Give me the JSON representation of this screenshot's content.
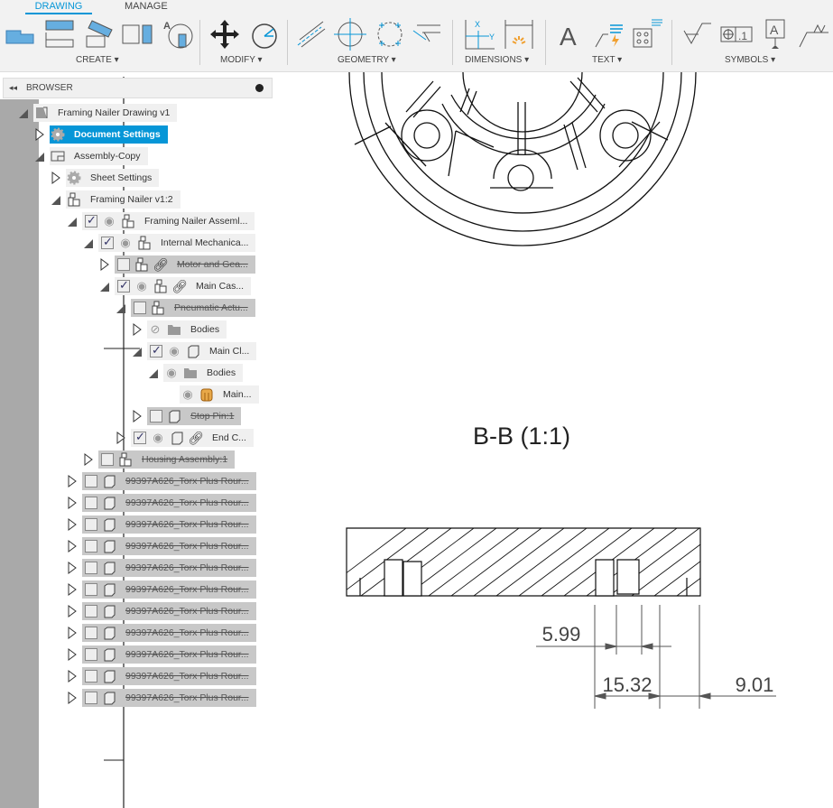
{
  "tabs": [
    {
      "label": "DRAWING",
      "active": true
    },
    {
      "label": "MANAGE",
      "active": false
    }
  ],
  "groups": [
    {
      "label": "CREATE ▾"
    },
    {
      "label": "MODIFY ▾"
    },
    {
      "label": "GEOMETRY ▾"
    },
    {
      "label": "DIMENSIONS ▾"
    },
    {
      "label": "TEXT ▾"
    },
    {
      "label": "SYMBOLS ▾"
    }
  ],
  "browser": {
    "title": "BROWSER",
    "collapse_icon": "double-chevron-left-icon",
    "minus_icon": "minus-circle-icon"
  },
  "tree": [
    {
      "label": "Framing Nailer Drawing v1",
      "level": 0,
      "exp": "open",
      "icon": "drawing",
      "state": "normal"
    },
    {
      "label": "Document Settings",
      "level": 1,
      "exp": "closed",
      "icon": "gear",
      "state": "sel"
    },
    {
      "label": "Assembly-Copy",
      "level": 1,
      "exp": "open",
      "icon": "sheet",
      "state": "normal"
    },
    {
      "label": "Sheet Settings",
      "level": 2,
      "exp": "closed",
      "icon": "gear",
      "state": "normal"
    },
    {
      "label": "Framing Nailer v1:2",
      "level": 2,
      "exp": "open",
      "icon": "assembly",
      "state": "normal"
    },
    {
      "label": "Framing Nailer Asseml...",
      "level": 3,
      "exp": "open",
      "cb": "on",
      "eye": "on",
      "icon": "assembly",
      "state": "normal"
    },
    {
      "label": "Internal Mechanica...",
      "level": 4,
      "exp": "open",
      "cb": "on",
      "eye": "on",
      "icon": "assembly",
      "state": "normal"
    },
    {
      "label": "Motor and Gea...",
      "level": 5,
      "exp": "closed",
      "cb": "off",
      "icon": "assembly",
      "link": true,
      "state": "supp"
    },
    {
      "label": "Main Cas...",
      "level": 5,
      "exp": "open",
      "cb": "on",
      "eye": "on",
      "icon": "assembly",
      "link": true,
      "state": "normal"
    },
    {
      "label": "Pneumatic Actu...",
      "level": 6,
      "exp": "open",
      "cb": "off",
      "icon": "assembly",
      "state": "supp"
    },
    {
      "label": "Bodies",
      "level": 7,
      "exp": "closed",
      "eye": "off",
      "icon": "folder",
      "state": "normal"
    },
    {
      "label": "Main Cl...",
      "level": 7,
      "exp": "open",
      "cb": "on",
      "eye": "on",
      "icon": "component",
      "state": "normal"
    },
    {
      "label": "Bodies",
      "level": 8,
      "exp": "open",
      "eye": "on",
      "icon": "folder",
      "state": "normal"
    },
    {
      "label": "Main...",
      "level": 9,
      "exp": "none",
      "eye": "on",
      "icon": "body",
      "state": "normal"
    },
    {
      "label": "Stop Pin:1",
      "level": 7,
      "exp": "closed",
      "cb": "off",
      "icon": "component",
      "state": "supp"
    },
    {
      "label": "End C...",
      "level": 6,
      "exp": "closed",
      "cb": "on",
      "eye": "on",
      "icon": "component",
      "link": true,
      "state": "normal"
    },
    {
      "label": "Housing Assembly:1",
      "level": 4,
      "exp": "closed",
      "cb": "off",
      "icon": "assembly",
      "state": "supp"
    },
    {
      "label": "99397A626_Torx Plus Rour...",
      "level": 3,
      "exp": "closed",
      "cb": "off",
      "icon": "component",
      "state": "supp"
    },
    {
      "label": "99397A626_Torx Plus Rour...",
      "level": 3,
      "exp": "closed",
      "cb": "off",
      "icon": "component",
      "state": "supp"
    },
    {
      "label": "99397A626_Torx Plus Rour...",
      "level": 3,
      "exp": "closed",
      "cb": "off",
      "icon": "component",
      "state": "supp"
    },
    {
      "label": "99397A626_Torx Plus Rour...",
      "level": 3,
      "exp": "closed",
      "cb": "off",
      "icon": "component",
      "state": "supp"
    },
    {
      "label": "99397A626_Torx Plus Rour...",
      "level": 3,
      "exp": "closed",
      "cb": "off",
      "icon": "component",
      "state": "supp"
    },
    {
      "label": "99397A626_Torx Plus Rour...",
      "level": 3,
      "exp": "closed",
      "cb": "off",
      "icon": "component",
      "state": "supp"
    },
    {
      "label": "99397A626_Torx Plus Rour...",
      "level": 3,
      "exp": "closed",
      "cb": "off",
      "icon": "component",
      "state": "supp"
    },
    {
      "label": "99397A626_Torx Plus Rour...",
      "level": 3,
      "exp": "closed",
      "cb": "off",
      "icon": "component",
      "state": "supp"
    },
    {
      "label": "99397A626_Torx Plus Rour...",
      "level": 3,
      "exp": "closed",
      "cb": "off",
      "icon": "component",
      "state": "supp"
    },
    {
      "label": "99397A626_Torx Plus Rour...",
      "level": 3,
      "exp": "closed",
      "cb": "off",
      "icon": "component",
      "state": "supp"
    },
    {
      "label": "99397A626_Torx Plus Rour...",
      "level": 3,
      "exp": "closed",
      "cb": "off",
      "icon": "component",
      "state": "supp"
    }
  ],
  "drawing": {
    "view_label": "B-B (1:1)",
    "dims": {
      "d1": "5.99",
      "d2": "15.32",
      "d3": "9.01"
    }
  },
  "colors": {
    "accent": "#0696d7",
    "toolbar": "#f2f2f2",
    "strip": "#a9a9a9"
  }
}
